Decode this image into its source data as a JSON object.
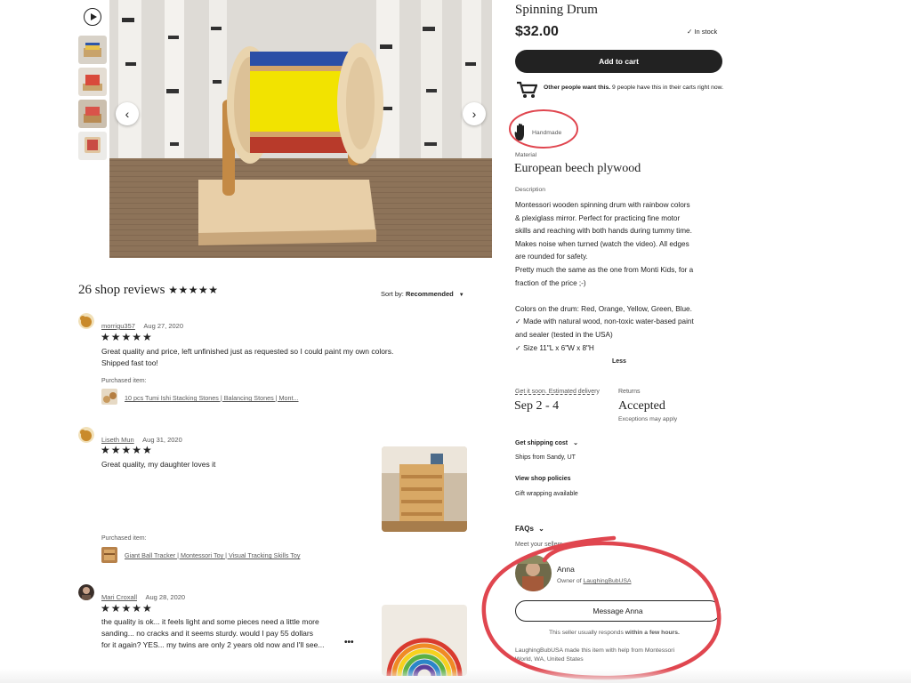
{
  "gallery": {
    "prev_icon": "chevron-left-icon",
    "next_icon": "chevron-right-icon",
    "play_icon": "play-icon"
  },
  "product": {
    "title": "Spinning Drum",
    "price": "$32.00",
    "stock": "In stock",
    "add_to_cart": "Add to cart",
    "demand_bold": "Other people want this.",
    "demand_text": " 9 people have this in their carts right now.",
    "handmade": "Handmade",
    "material_label": "Material",
    "material": "European beech plywood",
    "description_label": "Description",
    "description_lines": [
      "Montessori wooden spinning drum with rainbow colors",
      "& plexiglass mirror. Perfect for practicing fine motor",
      "skills and reaching with both hands during tummy time.",
      "Makes noise when turned (watch the video). All edges",
      "are rounded for safety.",
      "Pretty much the same as the one from Monti Kids, for a",
      "fraction of the price ;-)",
      "",
      "Colors on the drum: Red, Orange, Yellow, Green, Blue.",
      "✓ Made with natural wood, non-toxic water-based paint",
      "and sealer (tested in the USA)",
      "✓ Size 11\"L x 6\"W x 8\"H"
    ],
    "less": "Less"
  },
  "delivery": {
    "label": "Get it soon. Estimated delivery",
    "dates": "Sep 2 - 4",
    "returns_label": "Returns",
    "returns": "Accepted",
    "returns_sub": "Exceptions may apply",
    "shipping_cost": "Get shipping cost",
    "ships_from": "Ships from Sandy, UT",
    "policies": "View shop policies",
    "gift": "Gift wrapping available"
  },
  "seller": {
    "faqs": "FAQs",
    "meet": "Meet your sellers",
    "name": "Anna",
    "owner_prefix": "Owner of ",
    "shop": "LaughingBubUSA",
    "message_button": "Message Anna",
    "response_prefix": "This seller usually responds ",
    "response_time": "within a few hours.",
    "made_by": "LaughingBubUSA made this item with help from Montessori World, WA, United States"
  },
  "reviews": {
    "title": "26 shop reviews",
    "rating_stars": "★★★★★",
    "sort_label": "Sort by: ",
    "sort_value": "Recommended",
    "purchased_label": "Purchased item:",
    "items": [
      {
        "name": "morrigu357",
        "date": "Aug 27, 2020",
        "stars": "★★★★★",
        "text_lines": [
          "Great quality and price, left unfinished just as requested so I could paint my own colors.",
          "Shipped fast too!"
        ],
        "purchased": "10 pcs Tumi Ishi Stacking Stones | Balancing Stones | Mont..."
      },
      {
        "name": "Liseth Mun",
        "date": "Aug 31, 2020",
        "stars": "★★★★★",
        "text_lines": [
          "Great quality, my daughter loves it"
        ],
        "purchased": "Giant Ball Tracker | Montessori Toy | Visual Tracking Skills Toy"
      },
      {
        "name": "Mari Croxall",
        "date": "Aug 28, 2020",
        "stars": "★★★★★",
        "text_lines": [
          "the quality is ok... it feels light and some pieces need a little more",
          "sanding... no cracks and it seems sturdy. would I pay 55 dollars",
          "for it again? YES... my twins are only 2 years old now and I'll see..."
        ],
        "more": "•••"
      }
    ]
  },
  "colors": {
    "annotation_red": "#e0464f",
    "primary": "#222222"
  }
}
